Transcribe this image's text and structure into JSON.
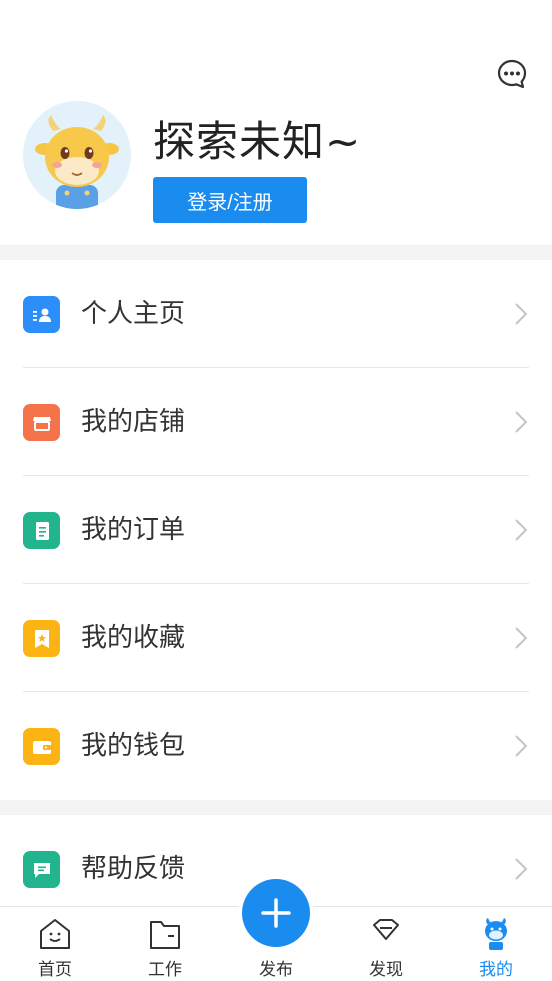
{
  "profile": {
    "username": "探索未知~",
    "login_label": "登录/注册"
  },
  "menu_group_1": [
    {
      "label": "个人主页",
      "icon": "profile-card-icon",
      "color": "#2c8ef8"
    },
    {
      "label": "我的店铺",
      "icon": "store-icon",
      "color": "#f5734a"
    },
    {
      "label": "我的订单",
      "icon": "order-icon",
      "color": "#22b48c"
    },
    {
      "label": "我的收藏",
      "icon": "favorite-icon",
      "color": "#fbb414"
    },
    {
      "label": "我的钱包",
      "icon": "wallet-icon",
      "color": "#fbb414"
    }
  ],
  "menu_group_2": [
    {
      "label": "帮助反馈",
      "icon": "feedback-icon",
      "color": "#22b48c"
    }
  ],
  "tabbar": {
    "home": "首页",
    "work": "工作",
    "publish": "发布",
    "discover": "发现",
    "mine": "我的"
  },
  "accent_color": "#1a8cf0"
}
